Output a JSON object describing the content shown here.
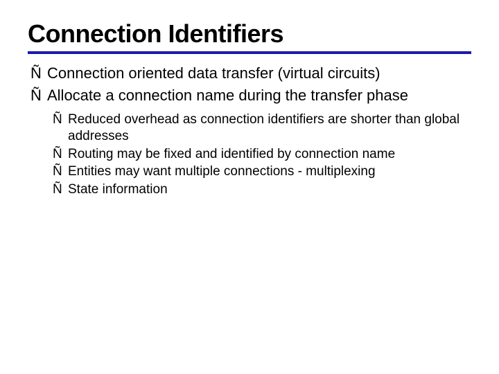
{
  "title": "Connection Identifiers",
  "bullets": [
    {
      "text": "Connection oriented data transfer (virtual circuits)"
    },
    {
      "text": "Allocate a connection name during the transfer phase"
    }
  ],
  "subbullets": [
    {
      "text": "Reduced overhead as connection identifiers are shorter than global addresses"
    },
    {
      "text": "Routing may be fixed and identified by connection name"
    },
    {
      "text": "Entities may want multiple connections - multiplexing"
    },
    {
      "text": "State information"
    }
  ]
}
